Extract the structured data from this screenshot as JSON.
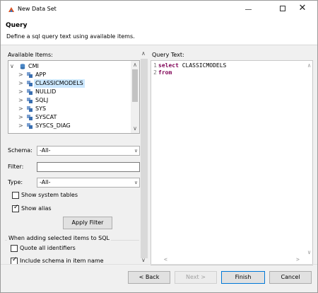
{
  "window": {
    "title": "New Data Set",
    "controls": {
      "minimize": "—",
      "maximize": "",
      "close": "✕"
    }
  },
  "header": {
    "title": "Query",
    "description": "Define a sql query text using available items."
  },
  "available": {
    "label": "Available Items:",
    "tree": [
      {
        "label": "CMI",
        "arrow": "∨",
        "icon": "database-icon",
        "level": 0
      },
      {
        "label": "APP",
        "arrow": ">",
        "icon": "schema-icon",
        "level": 1
      },
      {
        "label": "CLASSICMODELS",
        "arrow": ">",
        "icon": "schema-icon",
        "level": 1,
        "selected": true
      },
      {
        "label": "NULLID",
        "arrow": ">",
        "icon": "schema-icon",
        "level": 1
      },
      {
        "label": "SQLJ",
        "arrow": ">",
        "icon": "schema-icon",
        "level": 1
      },
      {
        "label": "SYS",
        "arrow": ">",
        "icon": "schema-icon",
        "level": 1
      },
      {
        "label": "SYSCAT",
        "arrow": ">",
        "icon": "schema-icon",
        "level": 1
      },
      {
        "label": "SYSCS_DIAG",
        "arrow": ">",
        "icon": "schema-icon",
        "level": 1
      }
    ]
  },
  "filters": {
    "schema_label": "Schema:",
    "schema_value": "-All-",
    "filter_label": "Filter:",
    "filter_value": "",
    "type_label": "Type:",
    "type_value": "-All-",
    "show_system_tables": "Show system tables",
    "show_system_tables_checked": false,
    "show_alias": "Show alias",
    "show_alias_checked": true,
    "apply_filter": "Apply Filter"
  },
  "adding": {
    "label": "When adding selected items to SQL",
    "quote_all": "Quote all identifiers",
    "quote_all_checked": false,
    "include_schema": "Include schema in item name",
    "include_schema_checked": true
  },
  "query": {
    "label": "Query Text:",
    "lines": [
      {
        "num": "1",
        "kw": "select",
        "rest": " CLASSICMODELS"
      },
      {
        "num": "2",
        "kw": "from",
        "rest": ""
      }
    ]
  },
  "footer": {
    "back": "< Back",
    "next": "Next >",
    "finish": "Finish",
    "cancel": "Cancel"
  },
  "colors": {
    "accent": "#0078d7",
    "selection": "#cce8ff",
    "keyword": "#7f0055",
    "app_icon": "#e0501b"
  }
}
